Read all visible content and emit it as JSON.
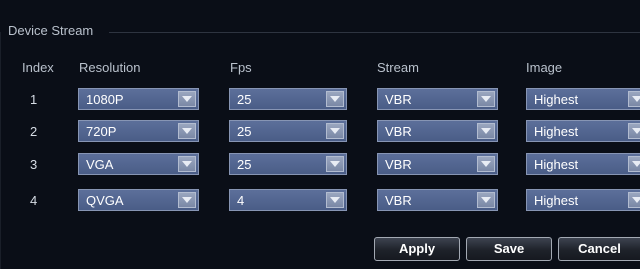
{
  "group": {
    "title": "Device Stream"
  },
  "headers": {
    "index": "Index",
    "resolution": "Resolution",
    "fps": "Fps",
    "stream": "Stream",
    "image": "Image"
  },
  "rows": [
    {
      "index": "1",
      "resolution": "1080P",
      "fps": "25",
      "stream": "VBR",
      "image": "Highest"
    },
    {
      "index": "2",
      "resolution": "720P",
      "fps": "25",
      "stream": "VBR",
      "image": "Highest"
    },
    {
      "index": "3",
      "resolution": "VGA",
      "fps": "25",
      "stream": "VBR",
      "image": "Highest"
    },
    {
      "index": "4",
      "resolution": "QVGA",
      "fps": "4",
      "stream": "VBR",
      "image": "Highest"
    }
  ],
  "buttons": {
    "apply": "Apply",
    "save": "Save",
    "cancel": "Cancel"
  },
  "icons": {
    "dropdown": "chevron-down-icon"
  },
  "colors": {
    "background": "#0a0e17",
    "select_fill": "#5c6f9a",
    "select_border": "#8795b4"
  }
}
